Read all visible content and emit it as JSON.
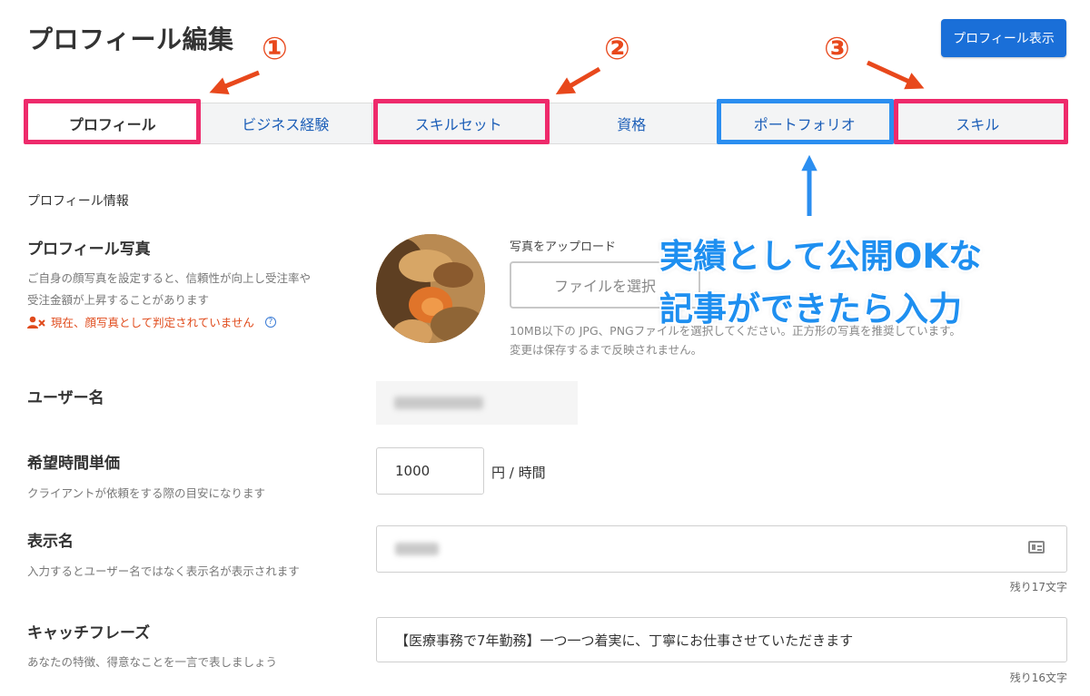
{
  "header": {
    "title": "プロフィール編集",
    "view_profile_label": "プロフィール表示"
  },
  "tabs": [
    {
      "label": "プロフィール",
      "active": true
    },
    {
      "label": "ビジネス経験",
      "active": false
    },
    {
      "label": "スキルセット",
      "active": false
    },
    {
      "label": "資格",
      "active": false
    },
    {
      "label": "ポートフォリオ",
      "active": false
    },
    {
      "label": "スキル",
      "active": false
    }
  ],
  "annotations": {
    "num1": "①",
    "num2": "②",
    "num3": "③",
    "callout_line1": "実績として公開OKな",
    "callout_line2": "記事ができたら入力",
    "highlight_pink": "#ee2a6b",
    "highlight_blue": "#2b8ef0",
    "arrow_color": "#e8481c"
  },
  "profile": {
    "section_label": "プロフィール情報",
    "photo": {
      "title": "プロフィール写真",
      "desc_line1": "ご自身の顔写真を設定すると、信頼性が向上し受注率や",
      "desc_line2": "受注金額が上昇することがあります",
      "warning": "現在、顔写真として判定されていません",
      "upload_label": "写真をアップロード",
      "file_button": "ファイルを選択",
      "note_line1": "10MB以下の JPG、PNGファイルを選択してください。正方形の写真を推奨しています。",
      "note_line2": "変更は保存するまで反映されません。"
    },
    "username": {
      "title": "ユーザー名"
    },
    "rate": {
      "title": "希望時間単価",
      "desc": "クライアントが依頼をする際の目安になります",
      "value": "1000",
      "unit": "円 / 時間"
    },
    "display_name": {
      "title": "表示名",
      "desc": "入力するとユーザー名ではなく表示名が表示されます",
      "remaining": "残り17文字"
    },
    "catchphrase": {
      "title": "キャッチフレーズ",
      "desc": "あなたの特徴、得意なことを一言で表しましょう",
      "value": "【医療事務で7年勤務】一つ一つ着実に、丁寧にお仕事させていただきます",
      "remaining": "残り16文字"
    }
  }
}
